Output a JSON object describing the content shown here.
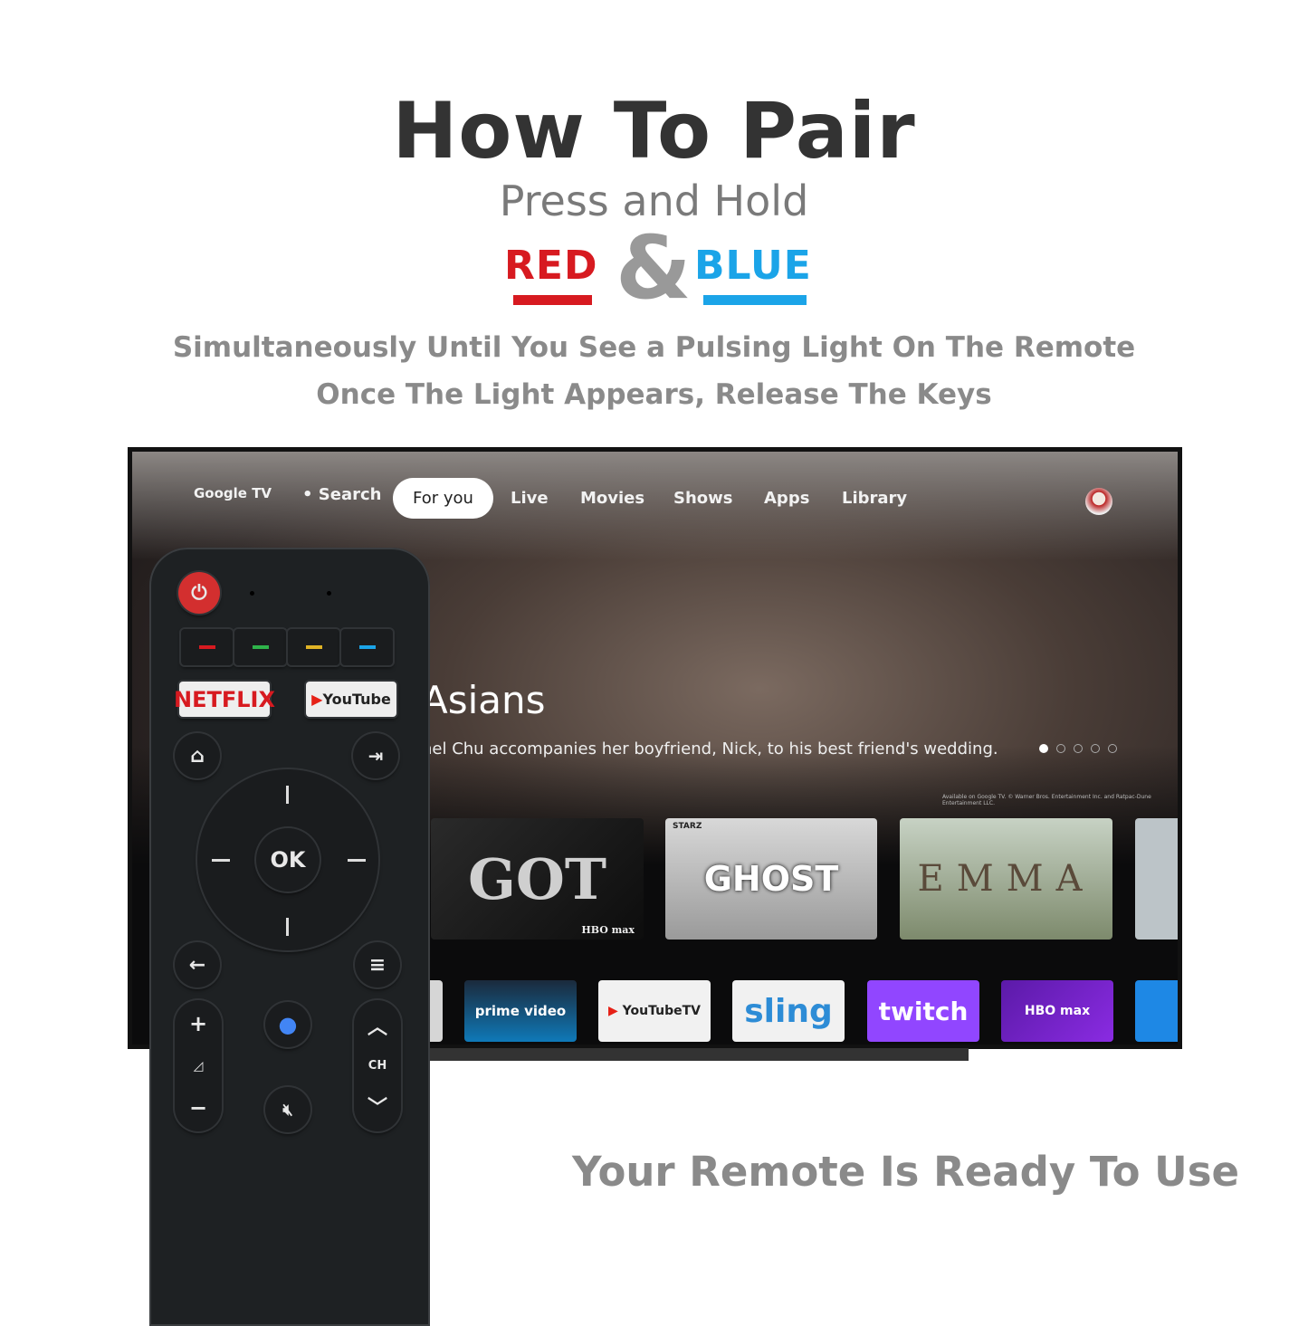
{
  "heading": {
    "title": "How To Pair",
    "subtitle": "Press and Hold",
    "key_red": "RED",
    "ampersand": "&",
    "key_blue": "BLUE",
    "line1": "Simultaneously Until You See a Pulsing Light On The Remote",
    "line2": "Once The Light Appears, Release The Keys"
  },
  "colors": {
    "red": "#d71a20",
    "blue": "#1ba4e8"
  },
  "tv": {
    "nav": {
      "logo": "Google TV",
      "search": "Search",
      "tabs": [
        "For you",
        "Live",
        "Movies",
        "Shows",
        "Apps",
        "Library"
      ],
      "active_tab": "For you"
    },
    "hero": {
      "title": "Asians",
      "description": "hel Chu accompanies her boyfriend, Nick, to his best friend's wedding.",
      "legal": "Available on Google TV. © Warner Bros. Entertainment Inc. and Ratpac-Dune Entertainment LLC.",
      "carousel_pages": 5,
      "carousel_active": 1
    },
    "cards": [
      "GOT",
      "GHOST",
      "EMMA"
    ],
    "card_badges": {
      "got": "HBO max",
      "ghost_top": "STARZ"
    },
    "apps": [
      "prime video",
      "YouTubeTV",
      "sling",
      "twitch",
      "HBO max"
    ]
  },
  "remote": {
    "netflix": "NETFLIX",
    "youtube": "YouTube",
    "ok": "OK",
    "ch": "CH",
    "plus": "+",
    "minus": "−"
  },
  "footer": "Your Remote Is Ready To Use"
}
